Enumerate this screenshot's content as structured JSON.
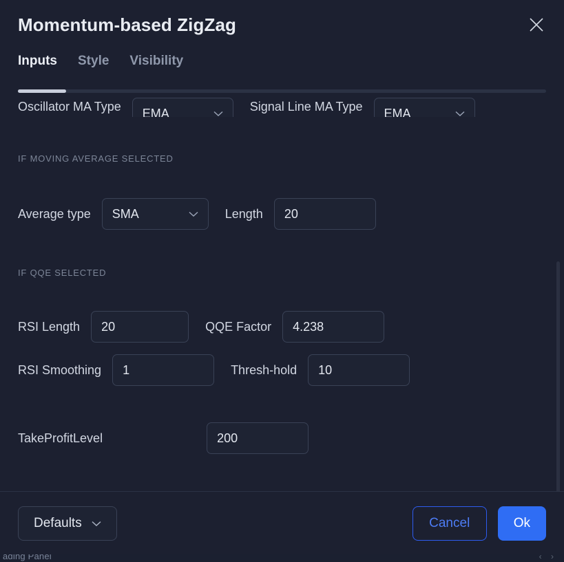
{
  "background": {
    "bottom_label": "ading Panel",
    "arrows": "‹ ›"
  },
  "dialog": {
    "title": "Momentum-based ZigZag",
    "close_icon": "close-icon"
  },
  "tabs": [
    {
      "label": "Inputs",
      "active": true
    },
    {
      "label": "Style",
      "active": false
    },
    {
      "label": "Visibility",
      "active": false
    }
  ],
  "form": {
    "clipped_row": {
      "oscillator_ma_type_label": "Oscillator MA Type",
      "oscillator_ma_type_value": "EMA",
      "signal_line_ma_type_label": "Signal Line MA Type",
      "signal_line_ma_type_value": "EMA"
    },
    "moving_average_section": {
      "heading": "IF MOVING AVERAGE SELECTED",
      "average_type_label": "Average type",
      "average_type_value": "SMA",
      "length_label": "Length",
      "length_value": "20"
    },
    "qqe_section": {
      "heading": "IF QQE SELECTED",
      "rsi_length_label": "RSI Length",
      "rsi_length_value": "20",
      "qqe_factor_label": "QQE Factor",
      "qqe_factor_value": "4.238",
      "rsi_smoothing_label": "RSI Smoothing",
      "rsi_smoothing_value": "1",
      "threshold_label": "Thresh-hold",
      "threshold_value": "10"
    },
    "take_profit": {
      "label": "TakeProfitLevel",
      "value": "200"
    }
  },
  "footer": {
    "defaults_label": "Defaults",
    "cancel_label": "Cancel",
    "ok_label": "Ok"
  },
  "colors": {
    "accent_blue": "#2f6df4",
    "cancel_blue": "#4d7cf5",
    "dialog_bg": "#1c2030",
    "control_border": "#3a4256"
  }
}
